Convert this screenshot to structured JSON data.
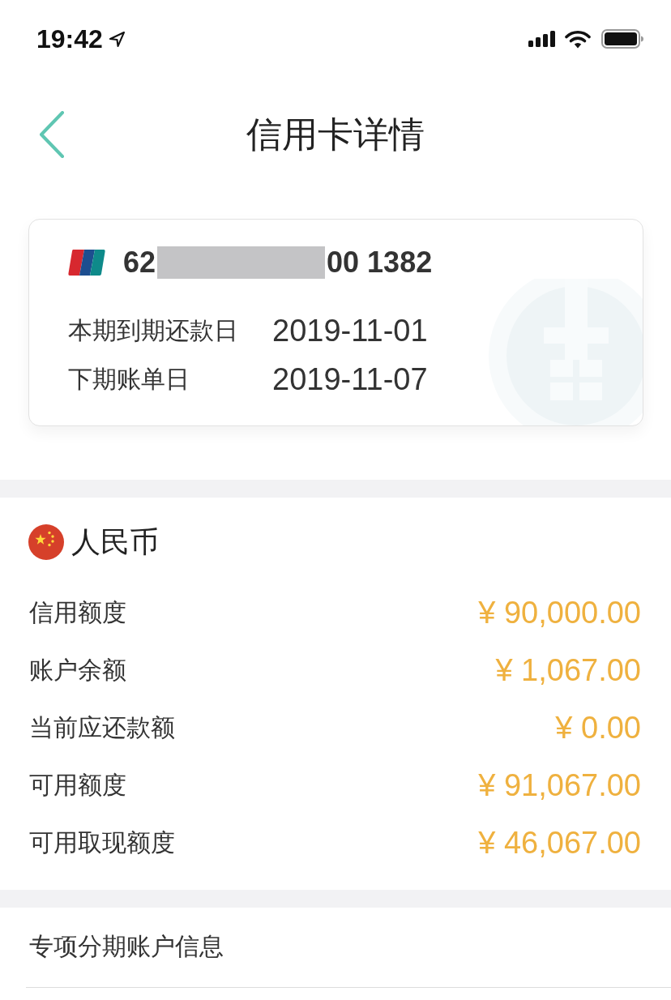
{
  "status_bar": {
    "time": "19:42"
  },
  "header": {
    "title": "信用卡详情"
  },
  "card": {
    "number_start": "62",
    "redacted": true,
    "number_end": "00 1382",
    "dates": [
      {
        "label": "本期到期还款日",
        "value": "2019-11-01"
      },
      {
        "label": "下期账单日",
        "value": "2019-11-07"
      }
    ]
  },
  "currency": {
    "name": "人民币",
    "rows": [
      {
        "label": "信用额度",
        "amount": "¥ 90,000.00"
      },
      {
        "label": "账户余额",
        "amount": "¥ 1,067.00"
      },
      {
        "label": "当前应还款额",
        "amount": "¥ 0.00"
      },
      {
        "label": "可用额度",
        "amount": "¥ 91,067.00"
      },
      {
        "label": "可用取现额度",
        "amount": "¥ 46,067.00"
      }
    ]
  },
  "installment": {
    "title": "专项分期账户信息"
  }
}
